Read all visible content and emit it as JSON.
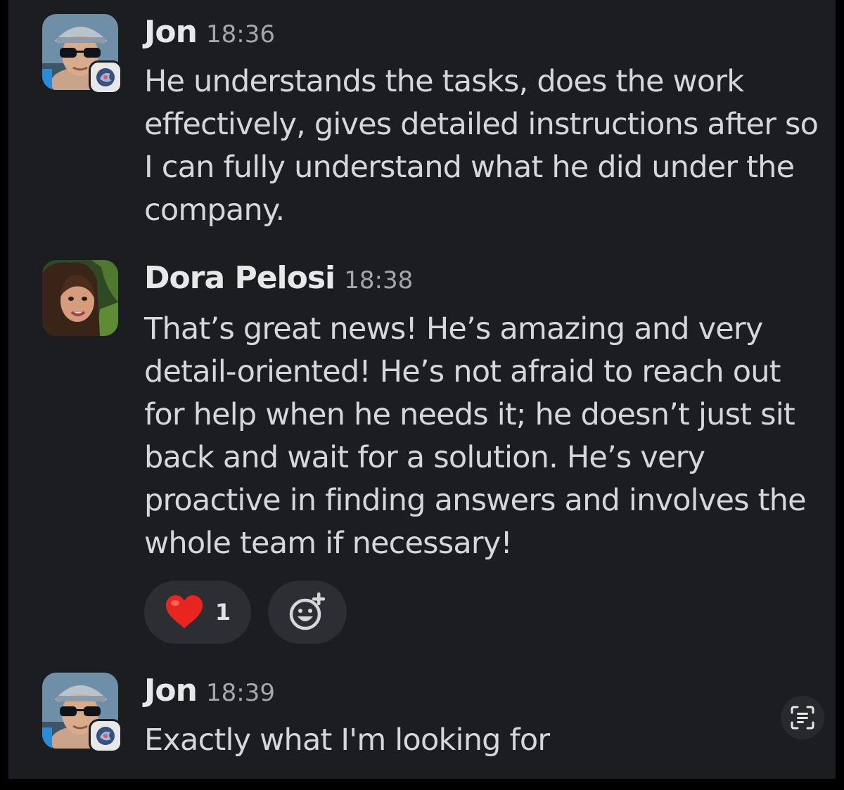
{
  "messages": [
    {
      "sender": "Jon",
      "time": "18:36",
      "text": "He understands the tasks, does the work effectively, gives detailed instructions after so I can fully understand what he did under the company."
    },
    {
      "sender": "Dora Pelosi",
      "time": "18:38",
      "text": "That’s great news! He’s amazing and very detail-oriented! He’s not afraid to reach out for help when he needs it; he doesn’t just sit back and wait for a solution. He’s very proactive in finding answers and involves the whole team if necessary!"
    },
    {
      "sender": "Jon",
      "time": "18:39",
      "text": "Exactly what I'm looking for"
    }
  ],
  "reactions": {
    "heart": {
      "emoji": "heart",
      "count": "1"
    },
    "add_reaction_icon": "add-reaction-icon"
  },
  "colors": {
    "background": "#1b1d21",
    "text": "#d6d7d8",
    "timestamp": "#a5a7aa",
    "reaction_pill": "#2c2e33",
    "heart": "#e8261f"
  }
}
